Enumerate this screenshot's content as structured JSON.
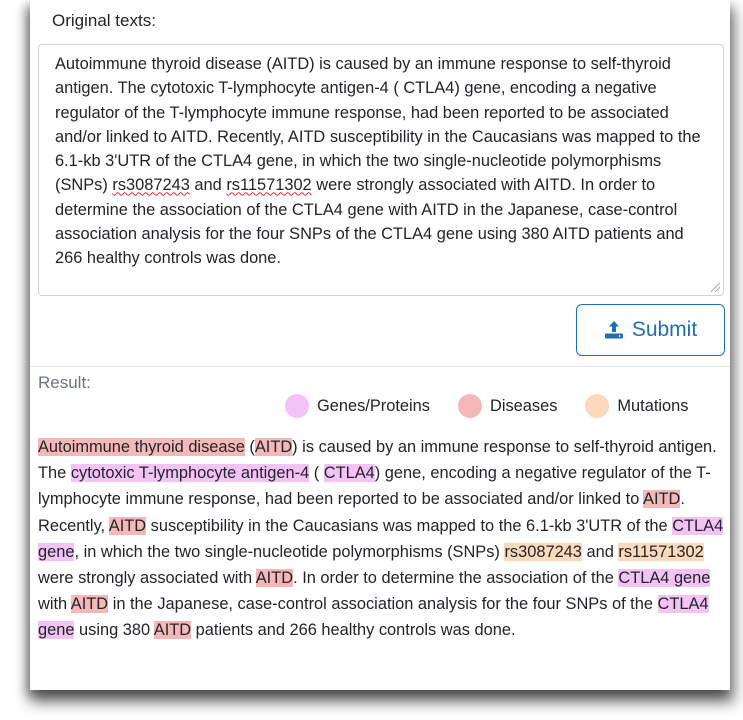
{
  "original": {
    "label": "Original texts:",
    "text_parts": [
      "Autoimmune thyroid disease (AITD) is caused by an immune response to self-thyroid antigen. The cytotoxic T-lymphocyte antigen-4 ( CTLA4) gene, encoding a negative regulator of the T-lymphocyte immune response, had been reported to be associated and/or linked to AITD. Recently, AITD susceptibility in the Caucasians was mapped to the 6.1-kb 3'UTR of the CTLA4 gene, in which the two single-nucleotide polymorphisms (SNPs) ",
      "rs3087243",
      " and ",
      "rs11571302",
      " were strongly associated with AITD. In order to determine the association of the CTLA4 gene with AITD in the Japanese, case-control association analysis for the four SNPs of the CTLA4 gene using 380 AITD patients and 266 healthy controls was done."
    ]
  },
  "submit": {
    "label": "Submit",
    "icon": "upload-icon"
  },
  "result": {
    "label": "Result:",
    "legend": [
      {
        "label": "Genes/Proteins",
        "color": "#f3c3f5"
      },
      {
        "label": "Diseases",
        "color": "#f5b8b8"
      },
      {
        "label": "Mutations",
        "color": "#fbd9bd"
      }
    ],
    "segments": [
      {
        "text": "Autoimmune thyroid disease",
        "type": "disease"
      },
      {
        "text": " (",
        "type": "plain"
      },
      {
        "text": "AITD",
        "type": "disease"
      },
      {
        "text": ") is caused by an immune response to self-thyroid antigen. The ",
        "type": "plain"
      },
      {
        "text": "cytotoxic T-lymphocyte antigen-4",
        "type": "gene"
      },
      {
        "text": " ( ",
        "type": "plain"
      },
      {
        "text": "CTLA4",
        "type": "gene"
      },
      {
        "text": ") gene, encoding a negative regulator of the T-lymphocyte immune response, had been reported to be associated and/or linked to ",
        "type": "plain"
      },
      {
        "text": "AITD",
        "type": "disease"
      },
      {
        "text": ". Recently, ",
        "type": "plain"
      },
      {
        "text": "AITD",
        "type": "disease"
      },
      {
        "text": " susceptibility in the Caucasians was mapped to the 6.1-kb 3'UTR of the ",
        "type": "plain"
      },
      {
        "text": "CTLA4 gene",
        "type": "gene"
      },
      {
        "text": ", in which the two single-nucleotide polymorphisms (SNPs) ",
        "type": "plain"
      },
      {
        "text": "rs3087243",
        "type": "mutation"
      },
      {
        "text": " and ",
        "type": "plain"
      },
      {
        "text": "rs11571302",
        "type": "mutation"
      },
      {
        "text": " were strongly associated with ",
        "type": "plain"
      },
      {
        "text": "AITD",
        "type": "disease"
      },
      {
        "text": ". In order to determine the association of the ",
        "type": "plain"
      },
      {
        "text": "CTLA4 gene",
        "type": "gene"
      },
      {
        "text": " with ",
        "type": "plain"
      },
      {
        "text": "AITD",
        "type": "disease"
      },
      {
        "text": " in the Japanese, case-control association analysis for the four SNPs of the ",
        "type": "plain"
      },
      {
        "text": "CTLA4 gene",
        "type": "gene"
      },
      {
        "text": " using 380 ",
        "type": "plain"
      },
      {
        "text": "AITD",
        "type": "disease"
      },
      {
        "text": " patients and 266 healthy controls was done.",
        "type": "plain"
      }
    ]
  }
}
